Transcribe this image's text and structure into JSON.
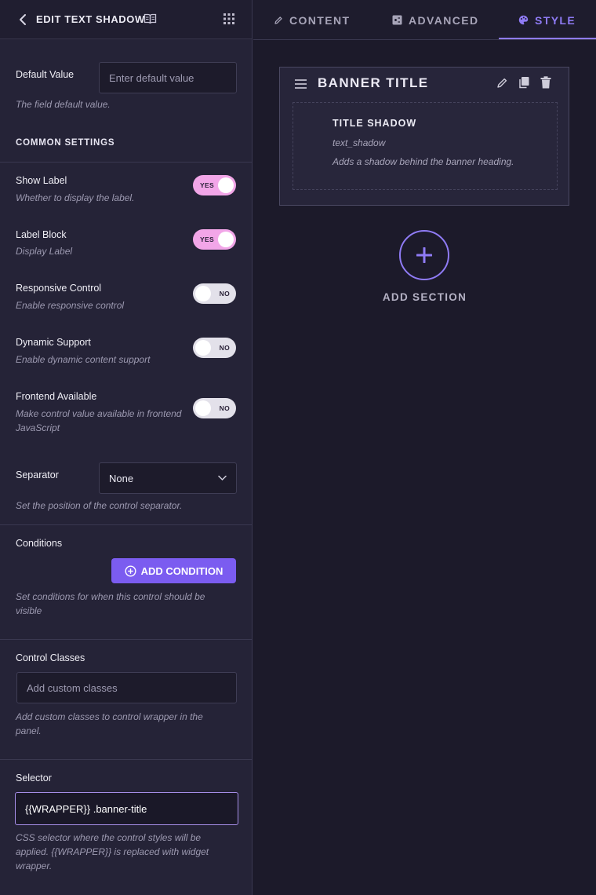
{
  "panel": {
    "title": "EDIT TEXT SHADOW",
    "default_value": {
      "label": "Default Value",
      "placeholder": "Enter default value",
      "desc": "The field default value."
    },
    "common_settings": "COMMON SETTINGS",
    "toggles": [
      {
        "label": "Show Label",
        "desc": "Whether to display the label.",
        "state": "YES"
      },
      {
        "label": "Label Block",
        "desc": "Display Label",
        "state": "YES"
      },
      {
        "label": "Responsive Control",
        "desc": "Enable responsive control",
        "state": "NO"
      },
      {
        "label": "Dynamic Support",
        "desc": "Enable dynamic content support",
        "state": "NO"
      },
      {
        "label": "Frontend Available",
        "desc_line1": "Make control value available in frontend",
        "desc_line2": "JavaScript",
        "state": "NO"
      }
    ],
    "separator": {
      "label": "Separator",
      "value": "None",
      "desc": "Set the position of the control separator."
    },
    "conditions": {
      "label": "Conditions",
      "button": "ADD CONDITION",
      "desc_line1": "Set conditions for when this control should be",
      "desc_line2": "visible"
    },
    "control_classes": {
      "label": "Control Classes",
      "placeholder": "Add custom classes",
      "desc_line1": "Add custom classes to control wrapper in the",
      "desc_line2": "panel."
    },
    "selector": {
      "label": "Selector",
      "value": "{{WRAPPER}} .banner-title",
      "desc_line1": "CSS selector where the control styles will be",
      "desc_line2": "applied. {{WRAPPER}} is replaced with widget",
      "desc_line3": "wrapper."
    }
  },
  "tabs": [
    {
      "label": "CONTENT",
      "icon": "pencil-icon"
    },
    {
      "label": "ADVANCED",
      "icon": "advanced-icon"
    },
    {
      "label": "STYLE",
      "icon": "palette-icon",
      "active": true
    }
  ],
  "card": {
    "title": "BANNER TITLE",
    "control": {
      "title": "TITLE SHADOW",
      "key": "text_shadow",
      "desc": "Adds a shadow behind the banner heading."
    }
  },
  "add_section": "ADD SECTION",
  "colors": {
    "accent": "#8f7bf5",
    "button": "#7b5cf0",
    "toggle_on": "#f2a6e8",
    "toggle_off": "#e3e1ea"
  }
}
